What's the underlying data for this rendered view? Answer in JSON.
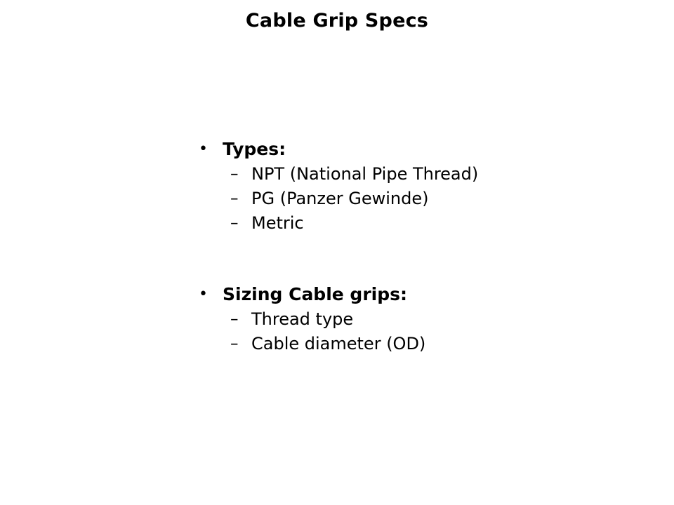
{
  "slide": {
    "title": "Cable Grip Specs",
    "background_color": "#ffffff",
    "text_color": "#000000",
    "level1_bullet_glyph": "•",
    "level2_bullet_glyph": "–",
    "groups": [
      {
        "heading": "Types:",
        "items": [
          "NPT (National Pipe Thread)",
          "PG (Panzer Gewinde)",
          "Metric"
        ]
      },
      {
        "heading": "Sizing Cable grips:",
        "items": [
          "Thread type",
          "Cable diameter (OD)"
        ]
      }
    ]
  }
}
